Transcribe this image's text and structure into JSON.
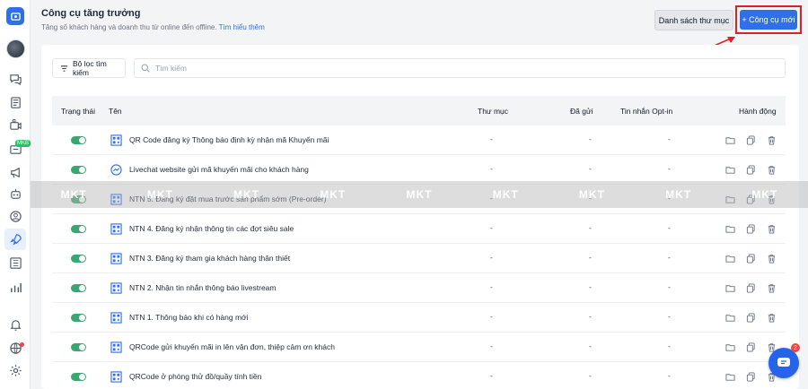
{
  "header": {
    "title": "Công cụ tăng trưởng",
    "subtitle": "Tăng số khách hàng và doanh thu từ online đến offline.",
    "learn_more": "Tìm hiểu thêm",
    "folders_button": "Danh sách thư mục",
    "new_tool_button": "+ Công cụ mới"
  },
  "sidebar": {
    "badge": "MKB"
  },
  "toolbar": {
    "filter_label": "Bộ lọc tìm kiếm",
    "search_placeholder": "Tìm kiếm"
  },
  "table": {
    "columns": [
      "Trạng thái",
      "Tên",
      "Thư mục",
      "Đã gửi",
      "Tin nhắn Opt-in",
      "Hành động"
    ],
    "rows": [
      {
        "name": "QR Code đăng ký Thông báo định kỳ nhận mã Khuyến mãi",
        "icon": "qr-code-icon",
        "folder": "-",
        "sent": "-",
        "optin": "-"
      },
      {
        "name": "Livechat website gửi mã khuyến mãi cho khách hàng",
        "icon": "messenger-icon",
        "folder": "-",
        "sent": "-",
        "optin": "-"
      },
      {
        "name": "NTN 5. Đăng ký đặt mua trước sản phẩm sớm (Pre-order)",
        "icon": "qr-code-icon",
        "folder": "-",
        "sent": "-",
        "optin": "-"
      },
      {
        "name": "NTN 4. Đăng ký nhận thông tin các đợt siêu sale",
        "icon": "qr-code-icon",
        "folder": "-",
        "sent": "-",
        "optin": "-"
      },
      {
        "name": "NTN 3. Đăng ký tham gia khách hàng thân thiết",
        "icon": "qr-code-icon",
        "folder": "-",
        "sent": "-",
        "optin": "-"
      },
      {
        "name": "NTN 2. Nhận tin nhắn thông báo livestream",
        "icon": "qr-code-icon",
        "folder": "-",
        "sent": "-",
        "optin": "-"
      },
      {
        "name": "NTN 1. Thông báo khi có hàng mới",
        "icon": "qr-code-icon",
        "folder": "-",
        "sent": "-",
        "optin": "-"
      },
      {
        "name": "QRCode gửi khuyến mãi in lên vận đơn, thiệp cảm ơn khách",
        "icon": "qr-code-icon",
        "folder": "-",
        "sent": "-",
        "optin": "-"
      },
      {
        "name": "QRCode ở phòng thử đồ/quầy tính tiền",
        "icon": "qr-code-icon",
        "folder": "-",
        "sent": "-",
        "optin": "-"
      }
    ]
  },
  "watermark": [
    "MKT",
    "MKT",
    "MKT",
    "MKT",
    "MKT",
    "MKT",
    "MKT",
    "MKT",
    "MKT"
  ],
  "chat": {
    "badge_count": "2"
  },
  "colors": {
    "accent": "#2f6fe8",
    "toggle_on": "#3aa672",
    "highlight": "#e11d2a"
  }
}
